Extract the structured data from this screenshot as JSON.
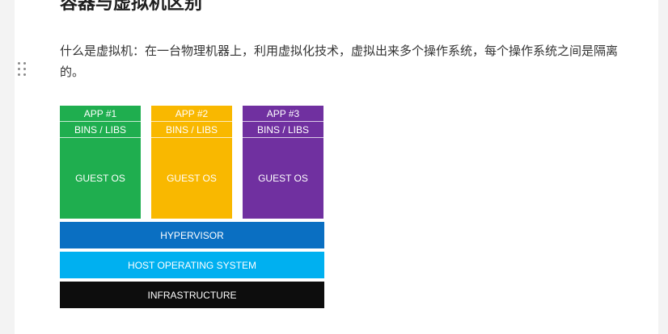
{
  "document": {
    "heading": "容器与虚拟机区别",
    "paragraph": "什么是虚拟机：在一台物理机器上，利用虚拟化技术，虚拟出来多个操作系统，每个操作系统之间是隔离的。"
  },
  "diagram": {
    "vms": [
      {
        "app": "APP #1",
        "bins": "BINS / LIBS",
        "os": "GUEST OS",
        "color": "#1fae4f"
      },
      {
        "app": "APP #2",
        "bins": "BINS / LIBS",
        "os": "GUEST OS",
        "color": "#f9b800"
      },
      {
        "app": "APP #3",
        "bins": "BINS / LIBS",
        "os": "GUEST OS",
        "color": "#7030a0"
      }
    ],
    "layers": [
      {
        "label": "HYPERVISOR",
        "color": "#0a6fc2"
      },
      {
        "label": "HOST OPERATING SYSTEM",
        "color": "#00b0f0"
      },
      {
        "label": "INFRASTRUCTURE",
        "color": "#0d0d0d"
      }
    ]
  }
}
